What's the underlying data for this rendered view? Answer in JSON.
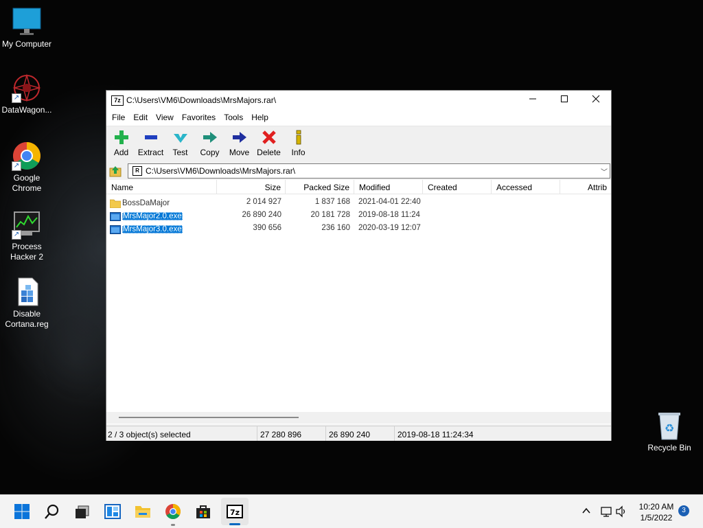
{
  "desktop": {
    "icons": [
      {
        "label": "My Computer"
      },
      {
        "label": "DataWagon..."
      },
      {
        "label": "Google Chrome"
      },
      {
        "label": "Process Hacker 2"
      },
      {
        "label": "Disable Cortana.reg"
      },
      {
        "label": "Recycle Bin"
      }
    ]
  },
  "window": {
    "app_icon": "7z",
    "title": "C:\\Users\\VM6\\Downloads\\MrsMajors.rar\\",
    "menu": [
      "File",
      "Edit",
      "View",
      "Favorites",
      "Tools",
      "Help"
    ],
    "toolbar": [
      {
        "label": "Add",
        "icon": "plus-icon",
        "color": "#22b14c"
      },
      {
        "label": "Extract",
        "icon": "minus-icon",
        "color": "#1f3fbf"
      },
      {
        "label": "Test",
        "icon": "check-icon",
        "color": "#2ab5c9"
      },
      {
        "label": "Copy",
        "icon": "copy-arrow-icon",
        "color": "#1f8f7a"
      },
      {
        "label": "Move",
        "icon": "move-arrow-icon",
        "color": "#1f2f9f"
      },
      {
        "label": "Delete",
        "icon": "delete-x-icon",
        "color": "#e02020"
      },
      {
        "label": "Info",
        "icon": "info-icon",
        "color": "#d4b400"
      }
    ],
    "address": {
      "path": "C:\\Users\\VM6\\Downloads\\MrsMajors.rar\\"
    },
    "columns": [
      "Name",
      "Size",
      "Packed Size",
      "Modified",
      "Created",
      "Accessed",
      "Attrib"
    ],
    "rows": [
      {
        "name": "BossDaMajor",
        "type": "folder",
        "size": "2 014 927",
        "packed": "1 837 168",
        "modified": "2021-04-01 22:40",
        "selected": false
      },
      {
        "name": "MrsMajor2.0.exe",
        "type": "exe",
        "size": "26 890 240",
        "packed": "20 181 728",
        "modified": "2019-08-18 11:24",
        "selected": true
      },
      {
        "name": "MrsMajor3.0.exe",
        "type": "exe",
        "size": "390 656",
        "packed": "236 160",
        "modified": "2020-03-19 12:07",
        "selected": true
      }
    ],
    "status": {
      "selection": "2 / 3 object(s) selected",
      "size": "27 280 896",
      "packed": "26 890 240",
      "modified": "2019-08-18 11:24:34"
    }
  },
  "taskbar": {
    "time": "10:20 AM",
    "date": "1/5/2022",
    "notifications": "3"
  },
  "colors": {
    "selection": "#0078d7",
    "accent": "#1a5fb4"
  }
}
